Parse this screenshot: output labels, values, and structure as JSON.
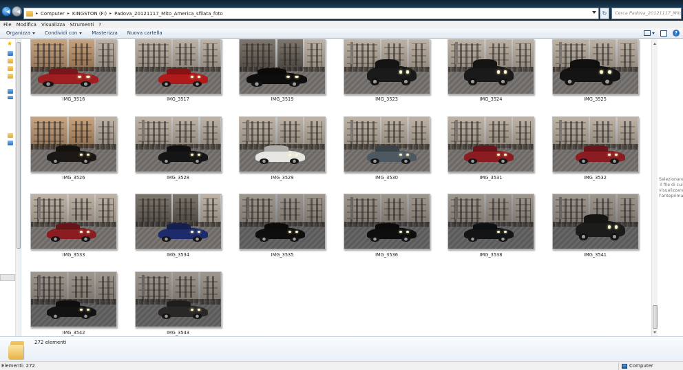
{
  "address": {
    "crumbs": [
      "Computer",
      "KINGSTON (F:)",
      "Padova_20121117_Mito_America_sfilata_foto"
    ],
    "search_placeholder": "Cerca Padova_20121117_Mito..."
  },
  "menu": [
    "File",
    "Modifica",
    "Visualizza",
    "Strumenti",
    "?"
  ],
  "toolbar": {
    "organize": "Organizza",
    "share": "Condividi con",
    "burn": "Masterizza",
    "new_folder": "Nuova cartella"
  },
  "files": [
    {
      "name": "IMG_3516",
      "scene": "red-camaro"
    },
    {
      "name": "IMG_3517",
      "scene": "street"
    },
    {
      "name": "IMG_3519",
      "scene": "black-challenger"
    },
    {
      "name": "IMG_3523",
      "scene": "jeep"
    },
    {
      "name": "IMG_3524",
      "scene": "jeep"
    },
    {
      "name": "IMG_3525",
      "scene": "jeep-close"
    },
    {
      "name": "IMG_3526",
      "scene": "black-sedan"
    },
    {
      "name": "IMG_3528",
      "scene": "black-car"
    },
    {
      "name": "IMG_3529",
      "scene": "white-corvette"
    },
    {
      "name": "IMG_3530",
      "scene": "grey-mustang"
    },
    {
      "name": "IMG_3531",
      "scene": "red-mustang"
    },
    {
      "name": "IMG_3532",
      "scene": "red-mustang"
    },
    {
      "name": "IMG_3533",
      "scene": "red-mustang"
    },
    {
      "name": "IMG_3534",
      "scene": "blue-car"
    },
    {
      "name": "IMG_3535",
      "scene": "black-corvette"
    },
    {
      "name": "IMG_3536",
      "scene": "black-corvette"
    },
    {
      "name": "IMG_3538",
      "scene": "black-mustang"
    },
    {
      "name": "IMG_3541",
      "scene": "hummer"
    },
    {
      "name": "IMG_3542",
      "scene": "black-trans-am"
    },
    {
      "name": "IMG_3543",
      "scene": "black-cadillac"
    }
  ],
  "preview_hint": "Selezionare il file di cui visualizzare l'anteprima.",
  "details": {
    "count": "272 elementi"
  },
  "status": {
    "left": "Elementi: 272",
    "right": "Computer"
  },
  "colors": {
    "titlebar": "#12283c",
    "toolbar_text": "#1e395b",
    "folder": "#e2a932"
  }
}
